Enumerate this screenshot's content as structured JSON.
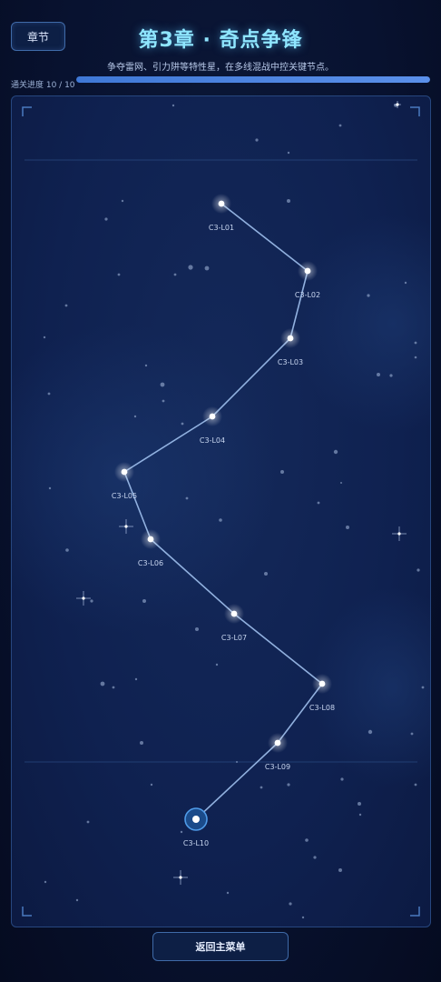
{
  "header": {
    "chapter_button_label": "章节",
    "title": "第3章 · 奇点争锋",
    "subtitle": "争夺雷网、引力阱等特性星，在多线混战中控关键节点。"
  },
  "progress": {
    "label": "通关进度 10 / 10",
    "cleared": 10,
    "total": 10,
    "fraction": 1.0
  },
  "levels": [
    {
      "id": "C3-L01",
      "state": "cleared"
    },
    {
      "id": "C3-L02",
      "state": "cleared"
    },
    {
      "id": "C3-L03",
      "state": "cleared"
    },
    {
      "id": "C3-L04",
      "state": "cleared"
    },
    {
      "id": "C3-L05",
      "state": "cleared"
    },
    {
      "id": "C3-L06",
      "state": "cleared"
    },
    {
      "id": "C3-L07",
      "state": "cleared"
    },
    {
      "id": "C3-L08",
      "state": "cleared"
    },
    {
      "id": "C3-L09",
      "state": "cleared"
    },
    {
      "id": "C3-L10",
      "state": "current"
    }
  ],
  "footer": {
    "back_button_label": "返回主菜单"
  },
  "colors": {
    "accent": "#8fe6ff",
    "path_line": "#9fc0ee",
    "node": "#ffffff",
    "current_ring": "#4f9be8"
  }
}
